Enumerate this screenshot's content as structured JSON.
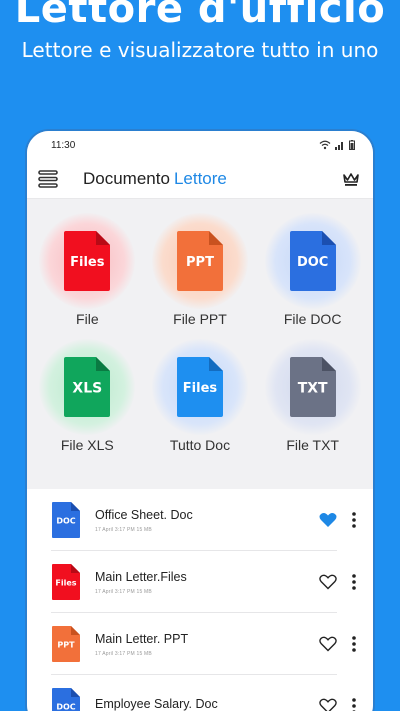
{
  "promo": {
    "title": "Lettore d'ufficio",
    "subtitle": "Lettore e visualizzatore tutto in uno"
  },
  "status": {
    "time": "11:30"
  },
  "appbar": {
    "title_main": "Documento",
    "title_accent": "Lettore"
  },
  "colors": {
    "files_red": "#f10f1f",
    "ppt_orange": "#f2703a",
    "doc_blue": "#2b6fe0",
    "xls_green": "#10a65c",
    "tutto_blue": "#1e8ff0",
    "txt_gray": "#6b7286",
    "accent": "#1e88e5"
  },
  "categories": [
    {
      "label": "File",
      "badge": "Files",
      "icon": "files-red-icon"
    },
    {
      "label": "File PPT",
      "badge": "PPT",
      "icon": "ppt-file-icon"
    },
    {
      "label": "File DOC",
      "badge": "DOC",
      "icon": "doc-file-icon"
    },
    {
      "label": "File XLS",
      "badge": "XLS",
      "icon": "xls-file-icon"
    },
    {
      "label": "Tutto Doc",
      "badge": "Files",
      "icon": "all-files-icon"
    },
    {
      "label": "File TXT",
      "badge": "TXT",
      "icon": "txt-file-icon"
    }
  ],
  "recent": [
    {
      "name": "Office Sheet. Doc",
      "meta": "17 April   3:17 PM   15 MB",
      "badge": "DOC",
      "favorite": true
    },
    {
      "name": "Main Letter.Files",
      "meta": "17 April   3:17 PM   15 MB",
      "badge": "Files",
      "favorite": false
    },
    {
      "name": "Main Letter. PPT",
      "meta": "17 April   3:17 PM   15 MB",
      "badge": "PPT",
      "favorite": false
    },
    {
      "name": "Employee Salary. Doc",
      "meta": "",
      "badge": "DOC",
      "favorite": false
    }
  ]
}
